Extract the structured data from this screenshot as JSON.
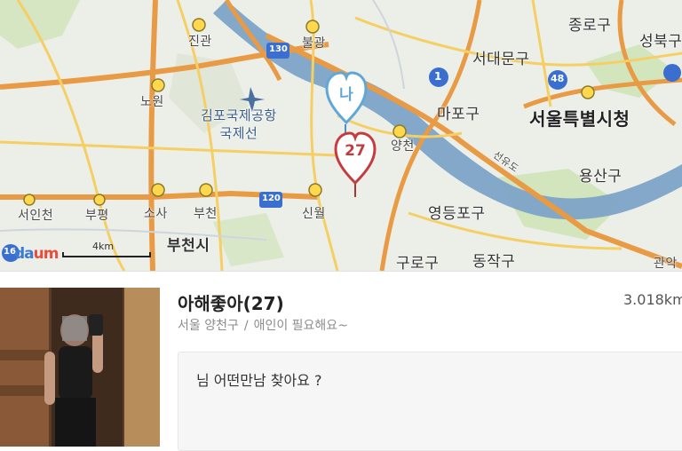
{
  "map": {
    "labels": {
      "jingwan": "진관",
      "eunpyeong": "불광",
      "nowon": "노원",
      "seodaemun": "서대문구",
      "jongno": "종로구",
      "seongbuk": "성북구",
      "mapo": "마포구",
      "seoul_city_hall": "서울특별시청",
      "gimpo_airport": "김포국제공항",
      "gimpo_airport_line2": "국제선",
      "yangcheon": "양천",
      "yongsan": "용산구",
      "yeongdeungpo": "영등포구",
      "seonyudo": "선유도",
      "bucheon": "부천",
      "bucheon_si": "부천시",
      "sosa": "소사",
      "bupyeong": "부평",
      "seoinchon": "서인천",
      "sinwol": "신월",
      "guro": "구로구",
      "dongjak": "동작구",
      "gwanak": "관악"
    },
    "route_badges": [
      "1",
      "48",
      "130",
      "120",
      "16"
    ],
    "pins": {
      "blue_text": "나",
      "red_text": "27"
    },
    "scale_text": "4km",
    "logo_text": "daum"
  },
  "profile": {
    "name": "아해좋아(27)",
    "distance": "3.018km",
    "location": "서울 양천구",
    "separator": "/",
    "tagline": "애인이 필요해요~",
    "message": "님 어떤만남 찾아요 ?"
  },
  "colors": {
    "river": "#7da3c7",
    "major_road": "#e89b44",
    "minor_road": "#f5cf63",
    "park": "#c9dfb1",
    "pin_blue": "#5fa7d8",
    "pin_red": "#c63b3f"
  }
}
